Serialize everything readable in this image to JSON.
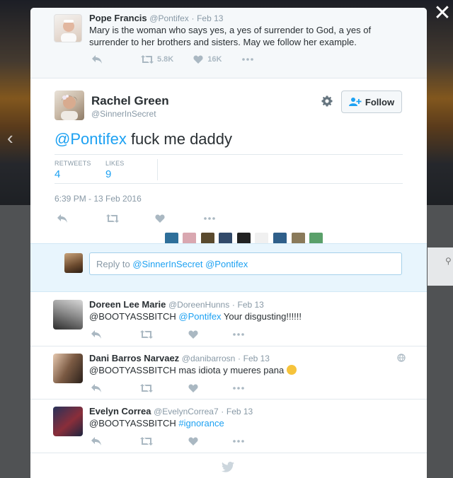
{
  "colors": {
    "link": "#1da1f2",
    "text": "#292f33",
    "muted": "#8899a6",
    "action": "#aab8c2"
  },
  "lightbox": {
    "close_glyph": "✕",
    "prev_glyph": "‹"
  },
  "ancestor": {
    "name": "Pope Francis",
    "handle": "@Pontifex",
    "sep": "·",
    "date": "Feb 13",
    "text": "Mary is the woman who says yes, a yes of surrender to God, a yes of surrender to her brothers and sisters. May we follow her example.",
    "retweets": "5.8K",
    "likes": "16K"
  },
  "tweet": {
    "name": "Rachel Green",
    "handle": "@SinnerInSecret",
    "mention": "@Pontifex",
    "text_rest": " fuck me daddy",
    "follow_label": "Follow",
    "retweets_label": "RETWEETS",
    "retweets": "4",
    "likes_label": "LIKES",
    "likes": "9",
    "timestamp": "6:39 PM - 13 Feb 2016"
  },
  "reply_box": {
    "prefix": "Reply to ",
    "mentions": "@SinnerInSecret @Pontifex"
  },
  "replies": [
    {
      "name": "Doreen Lee Marie",
      "handle": "@DoreenHunns",
      "sep": "·",
      "date": "Feb 13",
      "text": "@BOOTYASSBITCH ",
      "link": "@Pontifex",
      "text_after": " Your disgusting!!!!!!",
      "emoji": ""
    },
    {
      "name": "Dani Barros Narvaez",
      "handle": "@danibarrosn",
      "sep": "·",
      "date": "Feb 13",
      "text": "@BOOTYASSBITCH mas idiota y mueres pana",
      "link": "",
      "text_after": "",
      "emoji": "😒"
    },
    {
      "name": "Evelyn Correa",
      "handle": "@EvelynCorrea7",
      "sep": "·",
      "date": "Feb 13",
      "text": "@BOOTYASSBITCH ",
      "link": "#ignorance",
      "text_after": "",
      "emoji": ""
    }
  ]
}
